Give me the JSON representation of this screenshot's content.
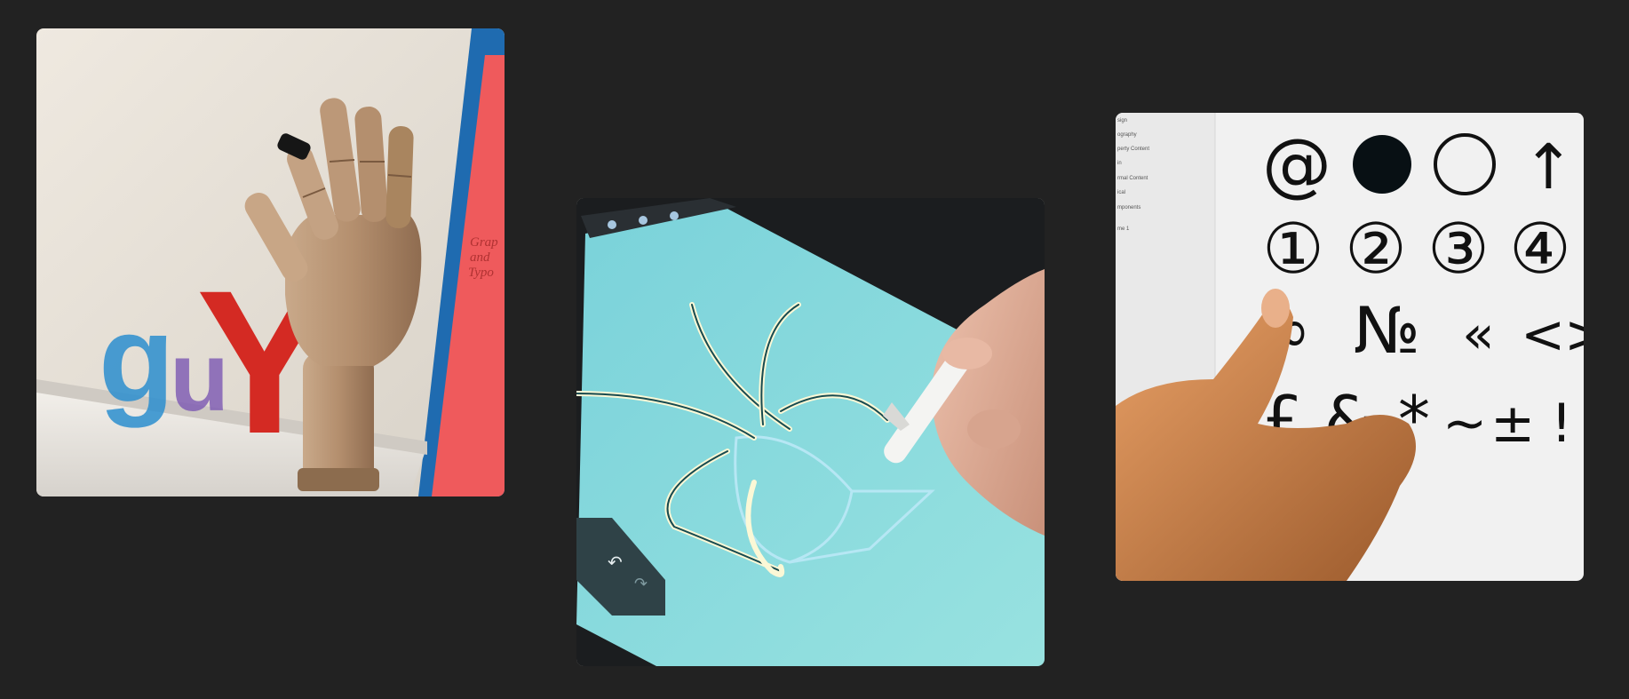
{
  "gallery": {
    "images": [
      {
        "name": "wooden-hand-photo",
        "letters": [
          "g",
          "u",
          "Y"
        ],
        "book_text": [
          "Grap",
          "and",
          "Typo"
        ]
      },
      {
        "name": "tablet-drawing-photo"
      },
      {
        "name": "glyph-screen-photo",
        "sidebar_items": [
          "sign",
          "ography",
          "perty Content",
          "in",
          "rmal Content",
          "ical",
          "mponents",
          "me 1"
        ],
        "glyph_rows": [
          [
            "@",
            "●",
            "○",
            "↑"
          ],
          [
            "①",
            "②",
            "③",
            "④"
          ],
          [
            "∞",
            "№",
            "«",
            "<",
            ">"
          ],
          [
            "£",
            "&",
            "*",
            "~",
            "±",
            "!"
          ]
        ]
      }
    ]
  }
}
